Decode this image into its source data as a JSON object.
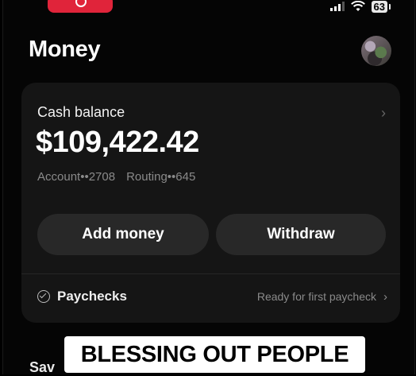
{
  "status_bar": {
    "battery": "63"
  },
  "header": {
    "title": "Money"
  },
  "cash_card": {
    "label": "Cash balance",
    "balance": "$109,422.42",
    "account": "Account••2708",
    "routing": "Routing••645",
    "add_money_label": "Add money",
    "withdraw_label": "Withdraw",
    "paychecks_label": "Paychecks",
    "paychecks_status": "Ready for first paycheck"
  },
  "savings": {
    "label": "Sav"
  },
  "caption": {
    "text": "BLESSING OUT PEOPLE"
  },
  "colors": {
    "accent": "#e0243a",
    "background": "#050505",
    "card": "#151515",
    "button": "#282828"
  },
  "icons": [
    "record-icon",
    "signal-icon",
    "wifi-icon",
    "battery-icon",
    "avatar",
    "chevron-right-icon",
    "check-circle-icon"
  ]
}
